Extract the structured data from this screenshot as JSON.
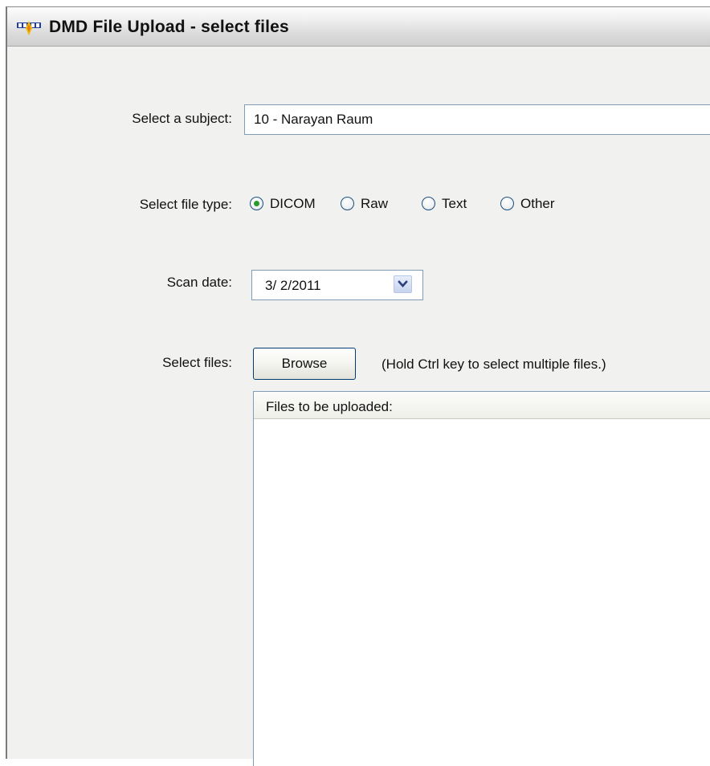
{
  "window": {
    "title": "DMD File Upload - select files",
    "icon": "app-logo-icon"
  },
  "subject": {
    "label": "Select a subject:",
    "value": "10 - Narayan Raum"
  },
  "file_type": {
    "label": "Select file type:",
    "options": [
      "DICOM",
      "Raw",
      "Text",
      "Other"
    ],
    "selected": "DICOM"
  },
  "scan_date": {
    "label": "Scan date:",
    "value": "3/ 2/2011",
    "dropdown_icon": "chevron-down-icon"
  },
  "files": {
    "label": "Select files:",
    "browse_label": "Browse",
    "hint": "(Hold Ctrl key to select multiple files.)",
    "list_header": "Files to be uploaded:",
    "items": []
  },
  "colors": {
    "radio_selected": "#2a9a2a",
    "input_border": "#7f9db9",
    "button_border": "#003c74",
    "window_bg": "#f1f1ef"
  }
}
